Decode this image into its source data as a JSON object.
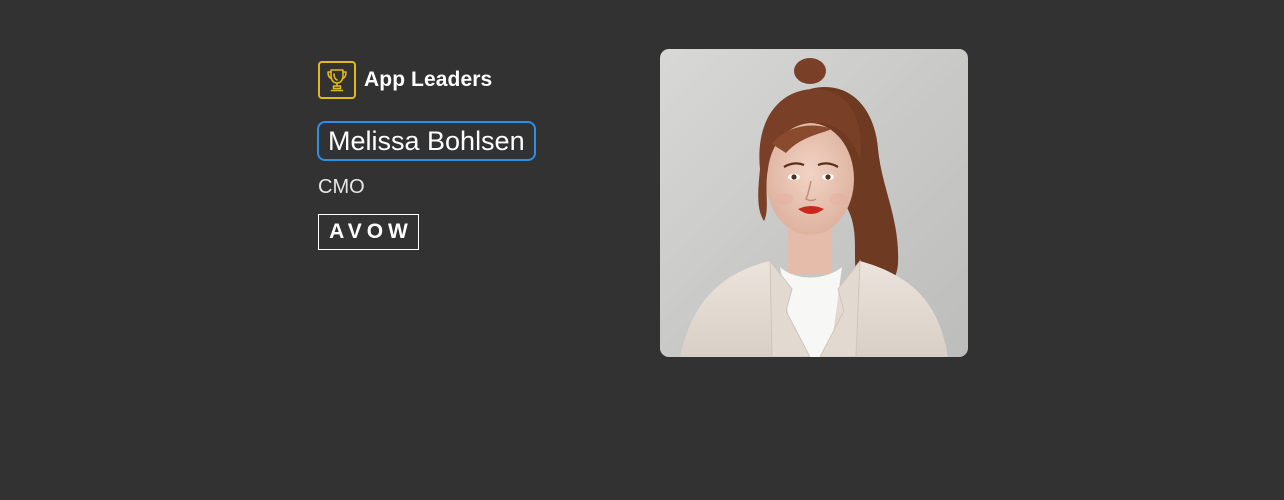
{
  "brand": {
    "name": "App Leaders",
    "icon": "trophy-icon",
    "icon_color": "#e5b81a"
  },
  "profile": {
    "name": "Melissa Bohlsen",
    "title": "CMO",
    "company_logo_text": "AVOW",
    "photo_alt": "Portrait of Melissa Bohlsen"
  },
  "colors": {
    "background": "#323232",
    "name_outline": "#2e8fe6",
    "accent": "#e5b81a"
  }
}
